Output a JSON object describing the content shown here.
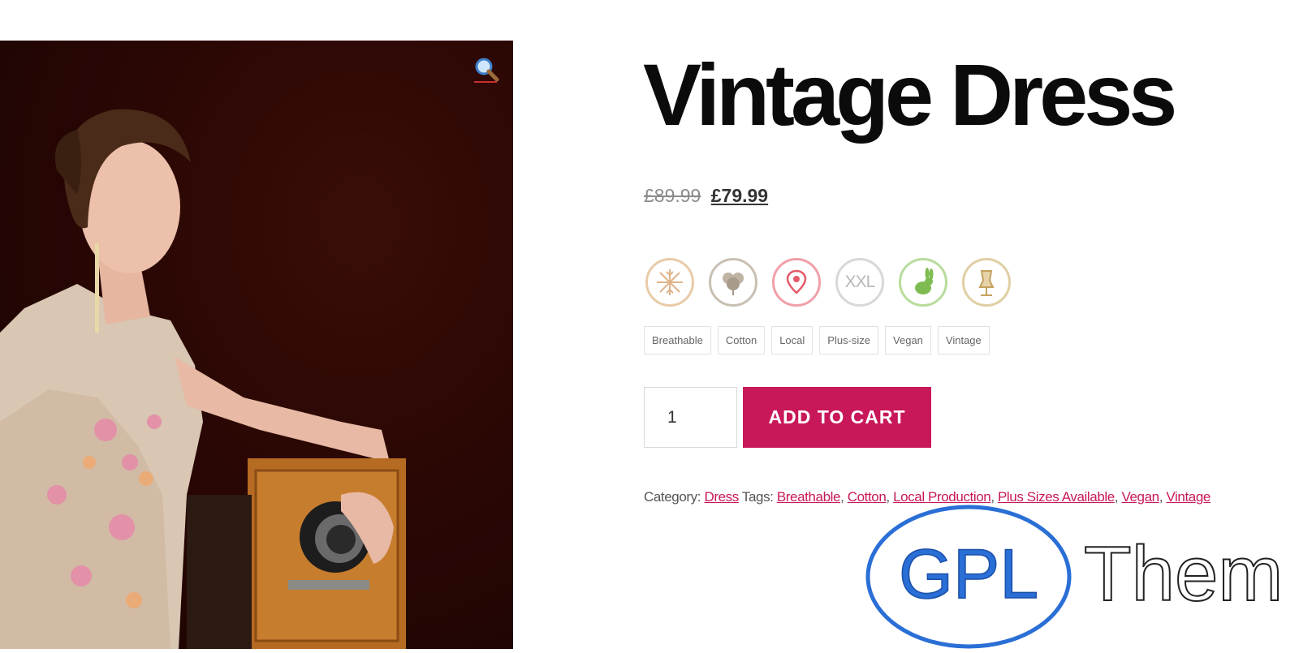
{
  "product": {
    "title": "Vintage Dress",
    "price_old": "£89.99",
    "price_new": "£79.99"
  },
  "badges": [
    {
      "icon": "snowflake-icon",
      "color": "#e0b48a"
    },
    {
      "icon": "cotton-icon",
      "color": "#a89b8a"
    },
    {
      "icon": "location-pin-icon",
      "color": "#e45a6a"
    },
    {
      "icon": "xxl-icon",
      "label": "XXL",
      "color": "#c8c8c8"
    },
    {
      "icon": "rabbit-icon",
      "color": "#7ebc52"
    },
    {
      "icon": "mannequin-icon",
      "color": "#c4a15e"
    }
  ],
  "tags": [
    "Breathable",
    "Cotton",
    "Local",
    "Plus-size",
    "Vegan",
    "Vintage"
  ],
  "cart": {
    "quantity": "1",
    "button_label": "ADD TO CART"
  },
  "meta": {
    "category_label": "Category:",
    "category": "Dress",
    "tags_label": "Tags:",
    "tag_links": [
      "Breathable",
      "Cotton",
      "Local Production",
      "Plus Sizes Available",
      "Vegan",
      "Vintage"
    ]
  },
  "watermark": {
    "logo_text": "GPL",
    "suffix": "Them"
  },
  "colors": {
    "accent": "#c8185a",
    "watermark_blue": "#2a6fd6"
  }
}
